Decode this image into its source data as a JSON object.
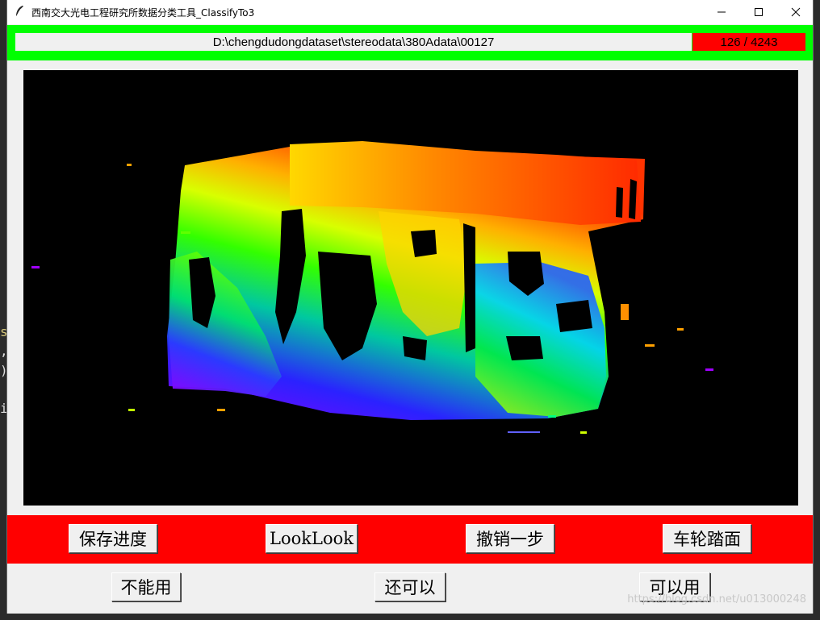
{
  "window": {
    "title": "西南交大光电工程研究所数据分类工具_ClassifyTo3",
    "controls": {
      "minimize": "minimize-icon",
      "maximize": "maximize-icon",
      "close": "close-icon"
    }
  },
  "path_bar": {
    "path": "D:\\chengdudongdataset\\stereodata\\380Adata\\00127",
    "counter": "126 / 4243",
    "background": "#00ff00",
    "counter_background": "#ff0000"
  },
  "canvas": {
    "description_icon": "disparity-map-image"
  },
  "buttons_row1": {
    "save": "保存进度",
    "look": "LookLook",
    "undo": "撤销一步",
    "wheel": "车轮踏面",
    "background": "#ff0000"
  },
  "buttons_row2": {
    "unusable": "不能用",
    "okay": "还可以",
    "usable": "可以用"
  },
  "watermark": "https://blog.csdn.net/u013000248",
  "edge_glyphs": [
    "s",
    ",",
    ")",
    "i"
  ]
}
